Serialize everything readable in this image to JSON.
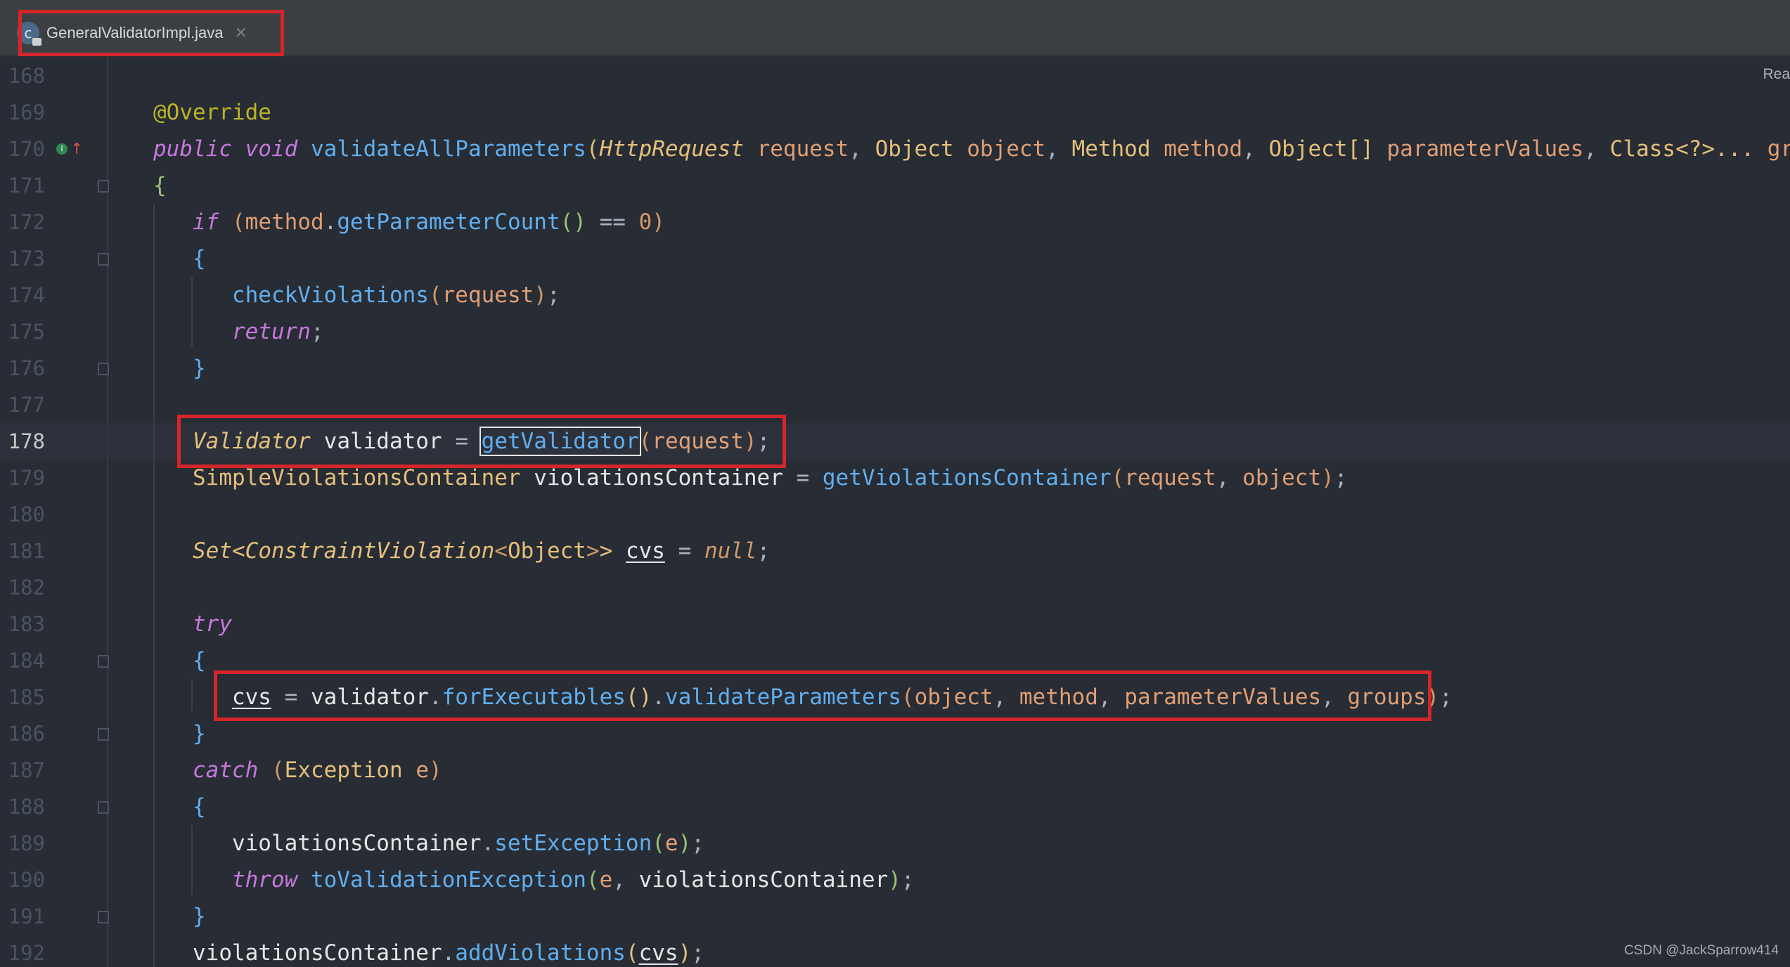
{
  "tab": {
    "title": "GeneralValidatorImpl.java",
    "close_icon": "✕"
  },
  "reader_label": "Rea",
  "watermark": "CSDN @JackSparrow414",
  "lines": [
    "168",
    "169",
    "170",
    "171",
    "172",
    "173",
    "174",
    "175",
    "176",
    "177",
    "178",
    "179",
    "180",
    "181",
    "182",
    "183",
    "184",
    "185",
    "186",
    "187",
    "188",
    "189",
    "190",
    "191",
    "192"
  ],
  "code": {
    "l169": {
      "annotation": "@Override"
    },
    "l170": {
      "kw1": "public",
      "kw2": "void",
      "method": "validateAllParameters",
      "t1": "HttpRequest",
      "p1": "request",
      "t2": "Object",
      "p2": "object",
      "t3": "Method",
      "p3": "method",
      "t4": "Object[]",
      "p4": "parameterValues",
      "t5": "Class<?>...",
      "p5": "groups)"
    },
    "l171": {
      "brace": "{"
    },
    "l172": {
      "kw": "if",
      "v": "method",
      "call": "getParameterCount",
      "op": "==",
      "num": "0"
    },
    "l173": {
      "brace": "{"
    },
    "l174": {
      "call": "checkViolations",
      "arg": "request"
    },
    "l175": {
      "kw": "return"
    },
    "l176": {
      "brace": "}"
    },
    "l178": {
      "type": "Validator",
      "var": "validator",
      "call": "getValidator",
      "arg": "request"
    },
    "l179": {
      "type": "SimpleViolationsContainer",
      "var": "violationsContainer",
      "call": "getViolationsContainer",
      "a1": "request",
      "a2": "object"
    },
    "l181": {
      "t1": "Set",
      "t2": "ConstraintViolation",
      "t3": "Object",
      "var": "cvs",
      "kw": "null"
    },
    "l183": {
      "kw": "try"
    },
    "l184": {
      "brace": "{"
    },
    "l185": {
      "var": "cvs",
      "obj": "validator",
      "c1": "forExecutables",
      "c2": "validateParameters",
      "a1": "object",
      "a2": "method",
      "a3": "parameterValues",
      "a4": "groups"
    },
    "l186": {
      "brace": "}"
    },
    "l187": {
      "kw": "catch",
      "type": "Exception",
      "p": "e"
    },
    "l188": {
      "brace": "{"
    },
    "l189": {
      "obj": "violationsContainer",
      "call": "setException",
      "arg": "e"
    },
    "l190": {
      "kw": "throw",
      "call": "toValidationException",
      "a1": "e",
      "a2": "violationsContainer"
    },
    "l191": {
      "brace": "}"
    },
    "l192": {
      "obj": "violationsContainer",
      "call": "addViolations",
      "arg": "cvs"
    }
  },
  "colors": {
    "highlight_box": "#d4262b",
    "background": "#282c34"
  }
}
